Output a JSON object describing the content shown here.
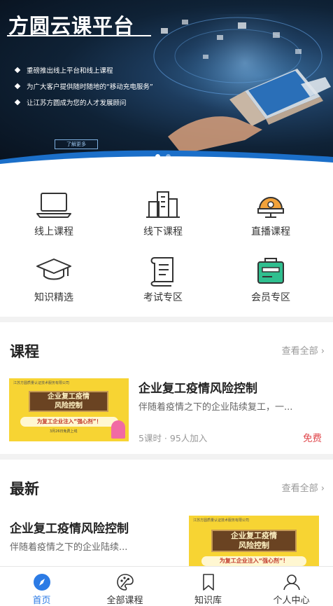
{
  "banner": {
    "title": "方圆云课平台",
    "bullets": [
      "重磅推出线上平台和线上课程",
      "为广大客户提供随时随地的“移动充电服务”",
      "让江苏方圆成为您的人才发展顾问"
    ],
    "more_label": "了解更多",
    "slide_count": 2,
    "active_slide": 1
  },
  "categories": [
    {
      "label": "线上课程",
      "icon": "laptop-icon"
    },
    {
      "label": "线下课程",
      "icon": "buildings-icon"
    },
    {
      "label": "直播课程",
      "icon": "alarm-bell-icon"
    },
    {
      "label": "知识精选",
      "icon": "graduation-cap-icon"
    },
    {
      "label": "考试专区",
      "icon": "scroll-icon"
    },
    {
      "label": "会员专区",
      "icon": "member-card-icon"
    }
  ],
  "courses_section": {
    "title": "课程",
    "see_all": "查看全部",
    "items": [
      {
        "title": "企业复工疫情风险控制",
        "desc": "伴随着疫情之下的企业陆续复工，一...",
        "meta": "5课时 · 95人加入",
        "price": "免费",
        "thumb": {
          "org": "江苏方圆质量认证技术服务有限公司",
          "panel_line1": "企业复工疫情",
          "panel_line2": "风险控制",
          "slogan": "为复工企业注入“强心剂”！",
          "date": "3月26日免费上线"
        }
      }
    ]
  },
  "latest_section": {
    "title": "最新",
    "see_all": "查看全部",
    "items": [
      {
        "title": "企业复工疫情风险控制",
        "desc": "伴随着疫情之下的企业陆续...",
        "thumb": {
          "org": "江苏方圆质量认证技术服务有限公司",
          "panel_line1": "企业复工疫情",
          "panel_line2": "风险控制",
          "slogan": "为复工企业注入“强心剂”！"
        }
      }
    ]
  },
  "tabbar": {
    "tabs": [
      {
        "label": "首页",
        "icon": "compass-icon",
        "active": true
      },
      {
        "label": "全部课程",
        "icon": "palette-icon",
        "active": false
      },
      {
        "label": "知识库",
        "icon": "bookmark-icon",
        "active": false
      },
      {
        "label": "个人中心",
        "icon": "user-icon",
        "active": false
      }
    ]
  },
  "colors": {
    "accent": "#2c7be5",
    "price": "#e0474c",
    "thumb_bg": "#f7d433"
  }
}
